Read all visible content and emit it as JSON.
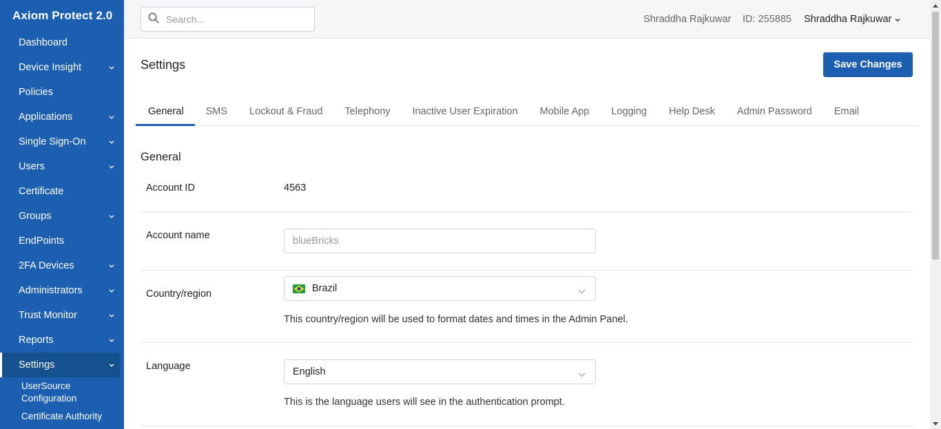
{
  "app": {
    "title": "Axiom Protect 2.0"
  },
  "sidebar": {
    "items": [
      {
        "label": "Dashboard",
        "has_chevron": false
      },
      {
        "label": "Device Insight",
        "has_chevron": true
      },
      {
        "label": "Policies",
        "has_chevron": false
      },
      {
        "label": "Applications",
        "has_chevron": true
      },
      {
        "label": "Single Sign-On",
        "has_chevron": true
      },
      {
        "label": "Users",
        "has_chevron": true
      },
      {
        "label": "Certificate",
        "has_chevron": false
      },
      {
        "label": "Groups",
        "has_chevron": true
      },
      {
        "label": "EndPoints",
        "has_chevron": false
      },
      {
        "label": "2FA Devices",
        "has_chevron": true
      },
      {
        "label": "Administrators",
        "has_chevron": true
      },
      {
        "label": "Trust Monitor",
        "has_chevron": true
      },
      {
        "label": "Reports",
        "has_chevron": true
      },
      {
        "label": "Settings",
        "has_chevron": true,
        "active": true
      }
    ],
    "sub_items": [
      {
        "label": "UserSource Configuration"
      },
      {
        "label": "Certificate Authority"
      }
    ]
  },
  "topbar": {
    "search_placeholder": "Search...",
    "user_name": "Shraddha Rajkuwar",
    "id_text": "ID: 255885",
    "menu_user": "Shraddha Rajkuwar"
  },
  "page": {
    "title": "Settings",
    "save_label": "Save Changes",
    "tabs": [
      {
        "label": "General",
        "active": true
      },
      {
        "label": "SMS"
      },
      {
        "label": "Lockout & Fraud"
      },
      {
        "label": "Telephony"
      },
      {
        "label": "Inactive User Expiration"
      },
      {
        "label": "Mobile App"
      },
      {
        "label": "Logging"
      },
      {
        "label": "Help Desk"
      },
      {
        "label": "Admin Password"
      },
      {
        "label": "Email"
      }
    ]
  },
  "general": {
    "section_title": "General",
    "account_id_label": "Account ID",
    "account_id_value": "4563",
    "account_name_label": "Account name",
    "account_name_placeholder": "blueBricks",
    "country_label": "Country/region",
    "country_value": "Brazil",
    "country_flag_icon": "brazil-flag-icon",
    "country_help": "This country/region will be used to format dates and times in the Admin Panel.",
    "language_label": "Language",
    "language_value": "English",
    "language_help": "This is the language users will see in the authentication prompt."
  },
  "colors": {
    "sidebar_bg": "#1c5fb0",
    "sidebar_active_bg": "#15508f",
    "accent": "#1c5fb0",
    "topbar_bg": "#f5f6f8"
  }
}
